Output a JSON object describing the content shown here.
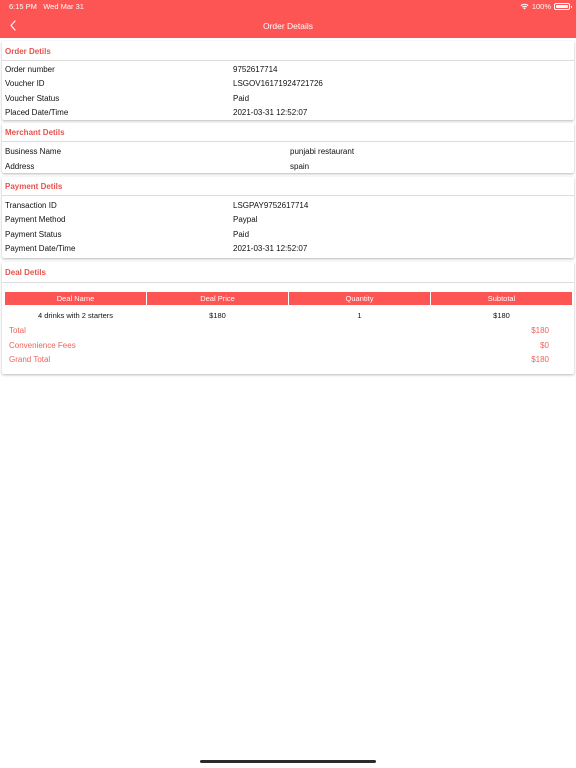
{
  "status_bar": {
    "time": "6:15 PM",
    "date": "Wed Mar 31",
    "battery": "100%"
  },
  "header": {
    "title": "Order Details"
  },
  "order": {
    "title": "Order Detils",
    "rows": [
      {
        "label": "Order number",
        "value": "9752617714"
      },
      {
        "label": "Voucher ID",
        "value": "LSGOV16171924721726"
      },
      {
        "label": "Voucher Status",
        "value": "Paid"
      },
      {
        "label": "Placed Date/Time",
        "value": "2021-03-31 12:52:07"
      }
    ]
  },
  "merchant": {
    "title": "Merchant Detils",
    "rows": [
      {
        "label": "Business Name",
        "value": "punjabi restaurant"
      },
      {
        "label": "Address",
        "value": "spain"
      }
    ]
  },
  "payment": {
    "title": "Payment Detils",
    "rows": [
      {
        "label": "Transaction ID",
        "value": "LSGPAY9752617714"
      },
      {
        "label": "Payment Method",
        "value": "Paypal"
      },
      {
        "label": "Payment Status",
        "value": "Paid"
      },
      {
        "label": "Payment Date/Time",
        "value": "2021-03-31 12:52:07"
      }
    ]
  },
  "deal": {
    "title": "Deal Detils",
    "columns": [
      "Deal Name",
      "Deal Price",
      "Quantity",
      "Subtotal"
    ],
    "items": [
      {
        "name": "4 drinks with 2 starters",
        "price": "$180",
        "quantity": "1",
        "subtotal": "$180"
      }
    ],
    "summary": [
      {
        "label": "Total",
        "value": "$180"
      },
      {
        "label": "Convenience Fees",
        "value": "$0"
      },
      {
        "label": "Grand Total",
        "value": "$180"
      }
    ]
  },
  "colors": {
    "accent": "#fc5553",
    "section_title": "#e8524d",
    "summary_text": "#f0625b"
  },
  "icons": {
    "back": "chevron-left-icon",
    "wifi": "wifi-icon",
    "battery": "battery-icon"
  }
}
